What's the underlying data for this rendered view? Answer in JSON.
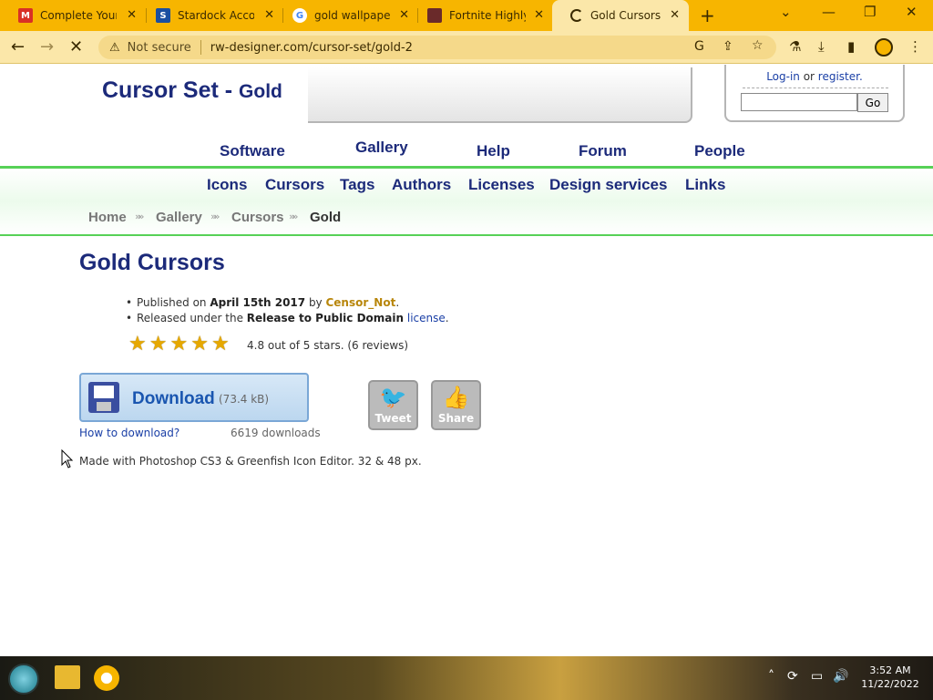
{
  "browser": {
    "tabs": [
      {
        "title": "Complete Your",
        "favicon": "gmail-icon",
        "active": false
      },
      {
        "title": "Stardock Accou",
        "favicon": "stardock-icon",
        "active": false
      },
      {
        "title": "gold wallpapers",
        "favicon": "google-icon",
        "active": false
      },
      {
        "title": "Fortnite Highly",
        "favicon": "fortnite-icon",
        "active": false
      },
      {
        "title": "Gold Cursors",
        "favicon": "loading-spinner-icon",
        "active": true
      }
    ],
    "security_label": "Not secure",
    "url": "rw-designer.com/cursor-set/gold-2",
    "accent": "#f7b500"
  },
  "site": {
    "title_main": "Cursor Set - ",
    "title_sub": "Gold",
    "login_text": "Log-in",
    "login_or": " or ",
    "register_text": "register.",
    "go_label": "Go",
    "main_nav": [
      "Software",
      "Gallery",
      "Help",
      "Forum",
      "People"
    ],
    "sub_nav": [
      "Icons",
      "Cursors",
      "Tags",
      "Authors",
      "Licenses",
      "Design services",
      "Links"
    ],
    "breadcrumb": [
      "Home",
      "Gallery",
      "Cursors",
      "Gold"
    ]
  },
  "content": {
    "heading": "Gold Cursors",
    "published_prefix": "Published on ",
    "published_date": "April 15th 2017",
    "published_by": " by ",
    "author": "Censor_Not",
    "published_end": ".",
    "released_prefix": "Released under the ",
    "license_name": "Release to Public Domain",
    "license_link": "license",
    "released_end": ".",
    "rating_text": "4.8 out of 5 stars. (6 reviews)",
    "rating_value": 4.8,
    "rating_max": 5,
    "download_label": "Download",
    "download_size": "(73.4 kB)",
    "how_to_download": "How to download?",
    "downloads_count": "6619 downloads",
    "tweet_label": "Tweet",
    "share_label": "Share",
    "made_with": "Made with Photoshop CS3 & Greenfish Icon Editor. 32 & 48 px."
  },
  "taskbar": {
    "time": "3:52 AM",
    "date": "11/22/2022"
  }
}
